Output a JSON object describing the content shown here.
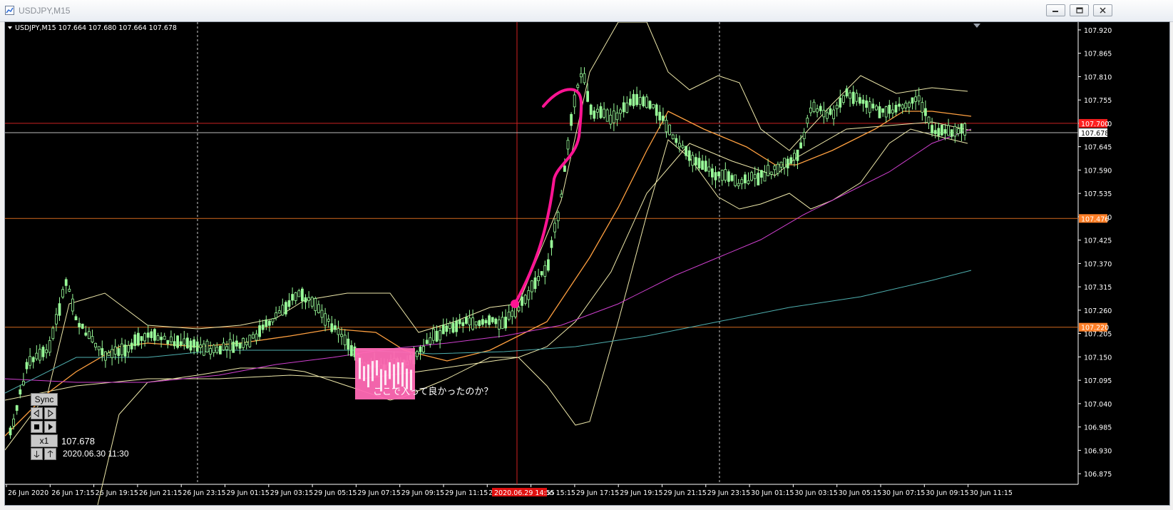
{
  "window": {
    "title": "USDJPY,M15",
    "icon": "chart-window-icon",
    "controls": [
      "minimize-icon",
      "restore-icon",
      "close-icon"
    ]
  },
  "chart": {
    "header_symbol": "USDJPY,M15",
    "header_ohlc": "107.664 107.680 107.664 107.678",
    "annotation_text": "ここで入って良かったのか？",
    "annotation_box_color": "#ff69b4",
    "hand_drawn_line_color": "#ff1493"
  },
  "chart_data": {
    "type": "candlestick",
    "symbol": "USDJPY",
    "timeframe": "M15",
    "ohlc_last": {
      "open": 107.664,
      "high": 107.68,
      "low": 107.664,
      "close": 107.678
    },
    "ylim": [
      106.85,
      107.935
    ],
    "y_ticks": [
      "107.920",
      "107.865",
      "107.810",
      "107.755",
      "107.700",
      "107.645",
      "107.590",
      "107.535",
      "107.480",
      "107.425",
      "107.370",
      "107.315",
      "107.260",
      "107.205",
      "107.150",
      "107.095",
      "107.040",
      "106.985",
      "106.930",
      "106.875"
    ],
    "x_ticks": [
      "26 Jun 2020",
      "26 Jun 17:15",
      "26 Jun 19:15",
      "26 Jun 21:15",
      "26 Jun 23:15",
      "29 Jun 01:15",
      "29 Jun 03:15",
      "29 Jun 05:15",
      "29 Jun 07:15",
      "29 Jun 09:15",
      "29 Jun 11:15",
      "29",
      "29 Jun 15:15",
      "29 Jun 17:15",
      "29 Jun 19:15",
      "29 Jun 21:15",
      "29 Jun 23:15",
      "30 Jun 01:15",
      "30 Jun 03:15",
      "30 Jun 05:15",
      "30 Jun 07:15",
      "30 Jun 09:15",
      "30 Jun 11:15"
    ],
    "price_labels": [
      {
        "value": "107.700",
        "color": "#ff2020",
        "line_color": "#cc2222"
      },
      {
        "value": "107.678",
        "color": "#ffffff",
        "line_color": "#bbbbbb"
      },
      {
        "value": "107.476",
        "color": "#ff7f27",
        "line_color": "#d2691e"
      },
      {
        "value": "107.220",
        "color": "#ff7f27",
        "line_color": "#d2691e"
      }
    ],
    "crosshair_time_label": "2020.06.29 14:55",
    "indicators": {
      "bollinger_color": "#eee8aa",
      "ma_short_color": "#ffa040",
      "ma_mid_color": "#d040d0",
      "ma_long_color": "#4fb0b0"
    },
    "candle_up_color": "#98fb98",
    "candle_down_color": "#98fb98",
    "grid": false
  },
  "replay": {
    "sync_label": "Sync",
    "speed_label": "x1",
    "price": "107.678",
    "datetime": "2020.06.30 11:30"
  }
}
